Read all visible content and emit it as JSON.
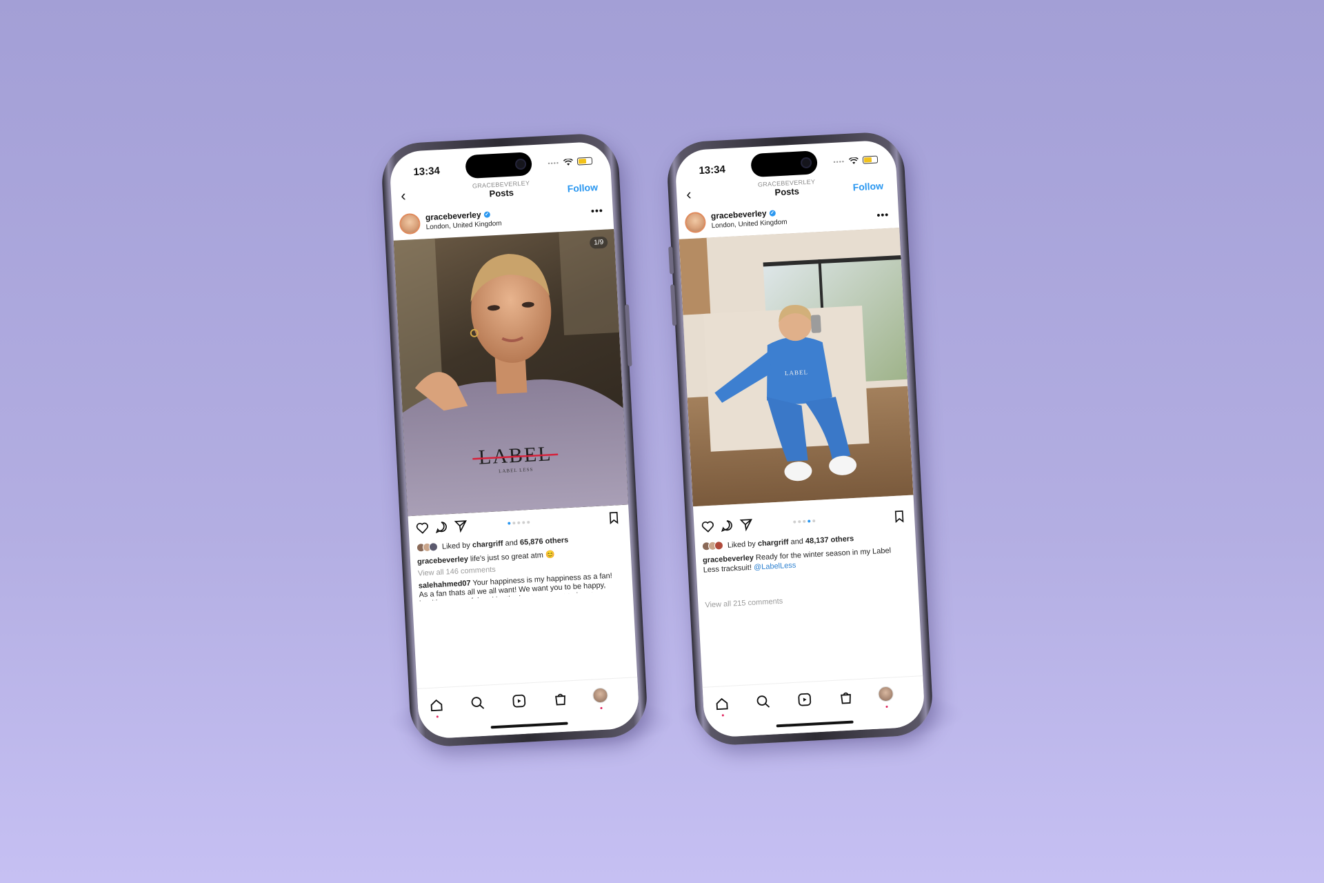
{
  "colors": {
    "background": "#a9a4dc",
    "accent": "#2a97f0",
    "notification": "#e0245e"
  },
  "left_phone": {
    "status": {
      "time": "13:34"
    },
    "nav": {
      "username": "GRACEBEVERLEY",
      "title": "Posts",
      "follow": "Follow"
    },
    "post": {
      "username": "gracebeverley",
      "location": "London, United Kingdom",
      "photo_counter": "1/9",
      "shirt_text": "LABEL",
      "shirt_subtext": "LABEL LESS",
      "liked_prefix": "Liked by",
      "liked_user": "chargriff",
      "liked_and": "and",
      "liked_count": "65,876 others",
      "caption_user": "gracebeverley",
      "caption_text": "life's just so great atm 😊",
      "view_comments": "View all 146 comments",
      "comment_user": "salehahmed07",
      "comment_text": "Your happiness is my happiness as a fan! As a fan thats all we all want! We want you to be happy, healthy, succesful and be the best you want to be at"
    }
  },
  "right_phone": {
    "status": {
      "time": "13:34"
    },
    "nav": {
      "username": "GRACEBEVERLEY",
      "title": "Posts",
      "follow": "Follow"
    },
    "post": {
      "username": "gracebeverley",
      "location": "London, United Kingdom",
      "sweatshirt_text": "LABEL",
      "liked_prefix": "Liked by",
      "liked_user": "chargriff",
      "liked_and": "and",
      "liked_count": "48,137 others",
      "caption_user": "gracebeverley",
      "caption_text": "Ready for the winter season in my Label Less tracksuit!",
      "caption_mention": "@LabelLess",
      "view_comments": "View all 215 comments"
    }
  }
}
